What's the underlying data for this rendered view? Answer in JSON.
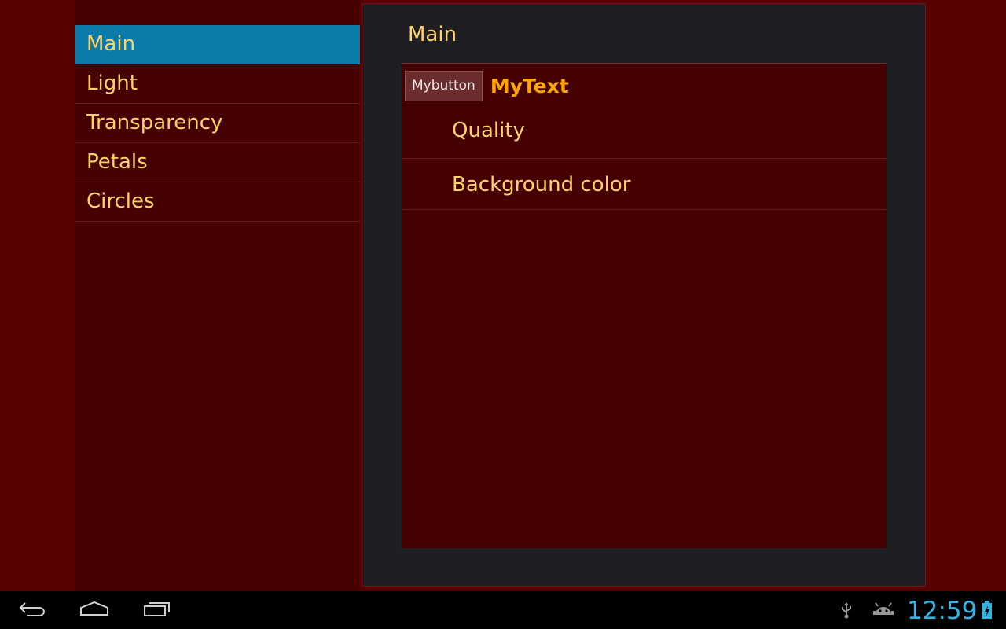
{
  "sidebar": {
    "items": [
      {
        "label": "Main",
        "selected": true
      },
      {
        "label": "Light"
      },
      {
        "label": "Transparency"
      },
      {
        "label": "Petals"
      },
      {
        "label": "Circles"
      }
    ]
  },
  "detail": {
    "title": "Main",
    "custom_row": {
      "button_label": "Mybutton",
      "text": "MyText"
    },
    "preferences": [
      {
        "label": "Quality"
      },
      {
        "label": "Background color"
      }
    ]
  },
  "navbar": {
    "icons": [
      "back-icon",
      "home-icon",
      "recent-apps-icon"
    ]
  },
  "status": {
    "time": "12:59",
    "icons": [
      "usb-icon",
      "android-debug-icon",
      "battery-charging-icon"
    ]
  },
  "colors": {
    "background": "#570000",
    "list_background": "#460000",
    "selected": "#0a7aa8",
    "text": "#ffd36a",
    "accent_text": "#ffa500",
    "clock": "#33b5e5"
  }
}
